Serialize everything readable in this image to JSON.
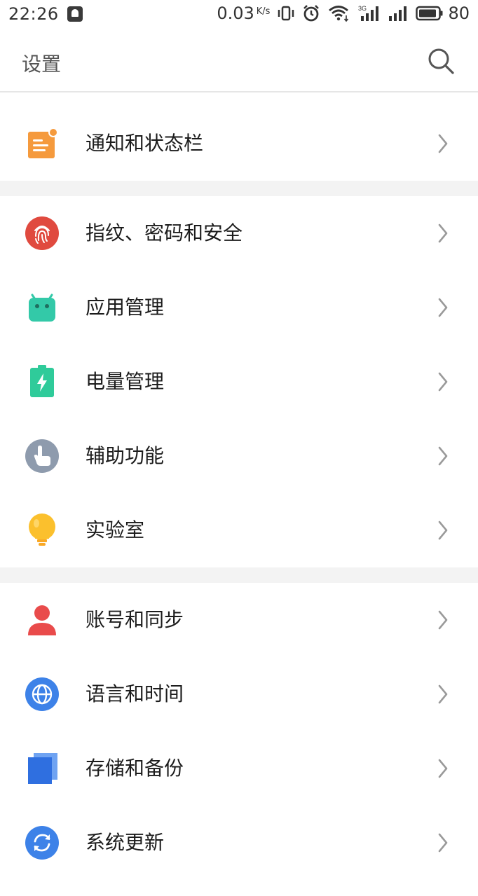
{
  "status_bar": {
    "time": "22:26",
    "net_speed": "0.03",
    "net_unit": "K/s",
    "network_type": "3G",
    "battery": "80"
  },
  "header": {
    "title": "设置"
  },
  "groups": [
    {
      "items": [
        {
          "label": "通知和状态栏",
          "icon": "notification-icon",
          "color": "#F59A3D"
        }
      ]
    },
    {
      "items": [
        {
          "label": "指纹、密码和安全",
          "icon": "fingerprint-icon",
          "color": "#E04A3F"
        },
        {
          "label": "应用管理",
          "icon": "android-icon",
          "color": "#33C9A8"
        },
        {
          "label": "电量管理",
          "icon": "battery-icon",
          "color": "#2FCB9A"
        },
        {
          "label": "辅助功能",
          "icon": "hand-icon",
          "color": "#8E9BAD"
        },
        {
          "label": "实验室",
          "icon": "lightbulb-icon",
          "color": "#FBC02D"
        }
      ]
    },
    {
      "items": [
        {
          "label": "账号和同步",
          "icon": "account-icon",
          "color": "#E94B4B"
        },
        {
          "label": "语言和时间",
          "icon": "globe-icon",
          "color": "#3D82E8"
        },
        {
          "label": "存储和备份",
          "icon": "storage-icon",
          "color": "#2F6FE0"
        },
        {
          "label": "系统更新",
          "icon": "update-icon",
          "color": "#3D82E8"
        }
      ]
    }
  ]
}
